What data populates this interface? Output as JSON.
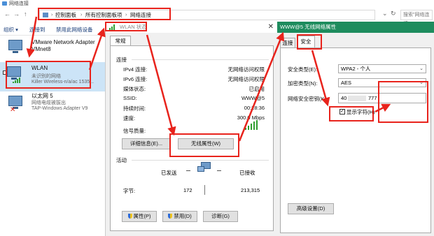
{
  "window": {
    "title": "网络连接"
  },
  "nav": {
    "back": "←",
    "forward": "→",
    "up": "↑"
  },
  "breadcrumb": [
    "控制面板",
    "所有控制面板项",
    "网络连接"
  ],
  "search": {
    "placeholder": "搜索\"网络连接\""
  },
  "toolbar": {
    "organize": "组织 ▾",
    "connect_to": "连接到",
    "disable_device": "禁用此网络设备"
  },
  "adapters": [
    {
      "name": "VMware Network Adapter VMnet8",
      "line1": "VMware Network Adapter",
      "line2": "VMnet8"
    },
    {
      "name": "WLAN",
      "status": "未识别的网络",
      "device": "Killer Wireless-n/a/ac 1535..."
    },
    {
      "name": "以太网 5",
      "status": "网络电缆被拔出",
      "device": "TAP-Windows Adapter V9"
    }
  ],
  "status_dialog": {
    "title": "WLAN 状态",
    "close": "✕",
    "tab_general": "常规",
    "section_connection": "连接",
    "rows": [
      {
        "label": "IPv4 连接:",
        "value": "无网络访问权限"
      },
      {
        "label": "IPv6 连接:",
        "value": "无网络访问权限"
      },
      {
        "label": "媒体状态:",
        "value": "已启用"
      },
      {
        "label": "SSID:",
        "value": "WWW@5"
      },
      {
        "label": "持续时间:",
        "value": "00:28:36"
      },
      {
        "label": "速度:",
        "value": "300.0 Mbps"
      }
    ],
    "signal_label": "信号质量:",
    "details_button": "详细信息(E)...",
    "wireless_props_button": "无线属性(W)",
    "section_activity": "活动",
    "sent_label": "已发送",
    "received_label": "已接收",
    "bytes_label": "字节:",
    "bytes_sent": "172",
    "bytes_received": "213,315",
    "properties_button": "属性(P)",
    "disable_button": "禁用(D)",
    "diagnose_button": "诊断(G)"
  },
  "props_dialog": {
    "title": "WWW@5 无线网络属性",
    "tab_connection": "连接",
    "tab_security": "安全",
    "security_type_label": "安全类型(E):",
    "security_type_value": "WPA2 - 个人",
    "encryption_type_label": "加密类型(N):",
    "encryption_type_value": "AES",
    "key_label": "网络安全密钥(K)",
    "key_value_start": "40",
    "key_value_end": "777",
    "show_chars_label": "显示字符(H)",
    "show_chars_checked": true,
    "advanced_button": "高级设置(D)"
  },
  "colors": {
    "annotation": "#e8231c",
    "props_title_bg": "#1e8c5e",
    "signal": "#2f9e2f"
  }
}
